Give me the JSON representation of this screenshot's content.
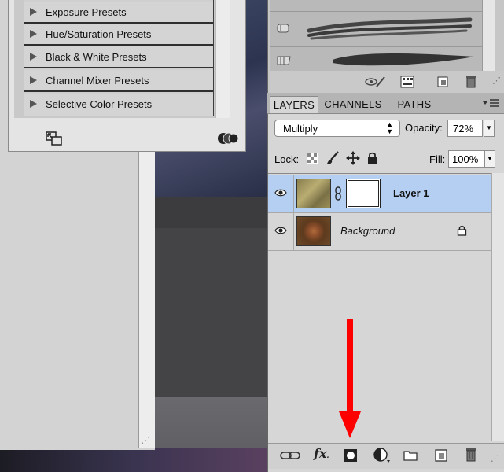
{
  "presets": {
    "items": [
      {
        "label": "Exposure Presets"
      },
      {
        "label": "Hue/Saturation Presets"
      },
      {
        "label": "Black & White Presets"
      },
      {
        "label": "Channel Mixer Presets"
      },
      {
        "label": "Selective Color Presets"
      }
    ]
  },
  "layers_panel": {
    "tabs": [
      {
        "label": "LAYERS",
        "active": true
      },
      {
        "label": "CHANNELS",
        "active": false
      },
      {
        "label": "PATHS",
        "active": false
      }
    ],
    "blend_mode": "Multiply",
    "opacity_label": "Opacity:",
    "opacity_value": "72%",
    "lock_label": "Lock:",
    "fill_label": "Fill:",
    "fill_value": "100%",
    "layers": [
      {
        "name": "Layer 1",
        "selected": true,
        "has_mask": true
      },
      {
        "name": "Background",
        "selected": false,
        "locked": true
      }
    ]
  },
  "toolbar_icons": [
    "link-icon",
    "fx-icon",
    "add-mask-icon",
    "adjustment-layer-icon",
    "folder-icon",
    "new-layer-icon",
    "trash-icon"
  ],
  "colors": {
    "selection": "#b5cff2",
    "annotation_arrow": "#ff0000"
  }
}
